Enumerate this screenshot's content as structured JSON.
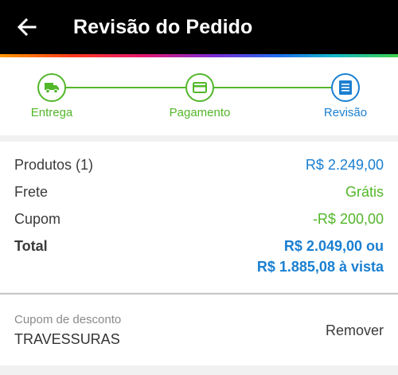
{
  "header": {
    "title": "Revisão do Pedido",
    "back_icon": "arrow-left-icon"
  },
  "stepper": {
    "steps": [
      {
        "label": "Entrega",
        "icon": "truck-icon",
        "state": "done"
      },
      {
        "label": "Pagamento",
        "icon": "credit-card-icon",
        "state": "done"
      },
      {
        "label": "Revisão",
        "icon": "list-icon",
        "state": "active"
      }
    ]
  },
  "summary": {
    "products_label": "Produtos (1)",
    "products_value": "R$ 2.249,00",
    "shipping_label": "Frete",
    "shipping_value": "Grátis",
    "coupon_label": "Cupom",
    "coupon_value": "-R$ 200,00",
    "total_label": "Total",
    "total_value_line1": "R$ 2.049,00 ou",
    "total_value_line2": "R$ 1.885,08 à vista"
  },
  "coupon": {
    "label": "Cupom de desconto",
    "code": "TRAVESSURAS",
    "remove_label": "Remover"
  },
  "colors": {
    "primary_blue": "#1a7fd1",
    "success_green": "#53b72a",
    "app_bar": "#000000"
  }
}
